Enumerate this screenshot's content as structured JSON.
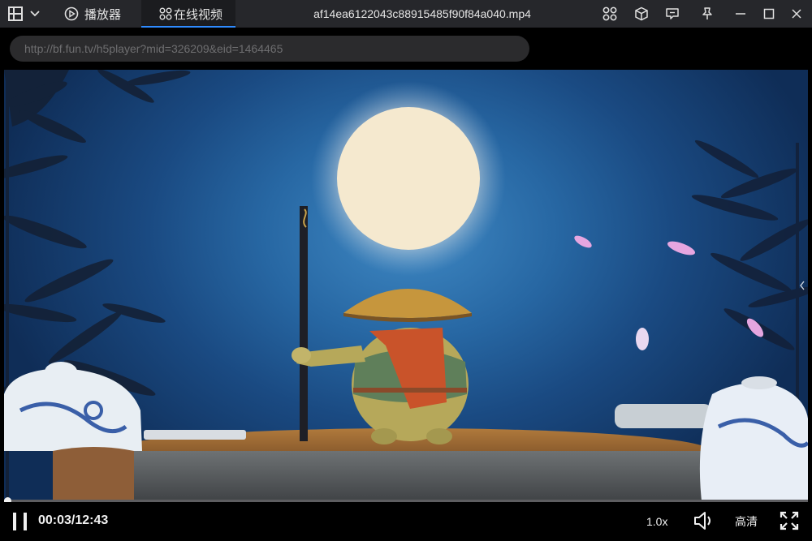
{
  "titlebar": {
    "tabs": [
      {
        "label": "播放器",
        "icon": "play-circle-icon",
        "active": false
      },
      {
        "label": "在线视频",
        "icon": "grid-icon",
        "active": true
      }
    ],
    "file_title": "af14ea6122043c88915485f90f84a040.mp4",
    "actions": [
      "grid-icon",
      "cube-icon",
      "chat-icon",
      "pin-icon",
      "minimize-icon",
      "maximize-icon",
      "close-icon"
    ]
  },
  "urlbar": {
    "url": "http://bf.fun.tv/h5player?mid=326209&eid=1464465"
  },
  "player": {
    "progress": 0.004,
    "current_time": "00:03",
    "total_time": "12:43",
    "time_display": "00:03/12:43",
    "speed": "1.0x",
    "quality": "高清"
  }
}
